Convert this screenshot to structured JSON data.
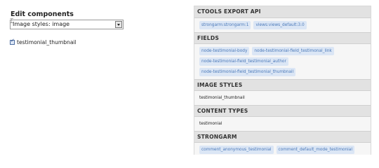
{
  "edit_components": {
    "title": "Edit components",
    "select_value": "Image styles: image",
    "checkbox_label": "testimonial_thumbnail",
    "checkbox_checked": true
  },
  "panel": {
    "sections": [
      {
        "heading": "CTOOLS EXPORT API",
        "kind": "tags",
        "items": [
          "strongarm:strongarm:1",
          "views:views_default:3.0"
        ]
      },
      {
        "heading": "FIELDS",
        "kind": "tags",
        "items": [
          "node-testimonial-body",
          "node-testimonial-field_testimonal_link",
          "node-testimonial-field_testimonial_author",
          "node-testimonial-field_testimonial_thumbnail"
        ]
      },
      {
        "heading": "IMAGE STYLES",
        "kind": "plain",
        "items": [
          "testimonial_thumbnail"
        ]
      },
      {
        "heading": "CONTENT TYPES",
        "kind": "plain",
        "items": [
          "testimonial"
        ]
      },
      {
        "heading": "STRONGARM",
        "kind": "tags",
        "items": [
          "comment_anonymous_testimonial",
          "comment_default_mode_testimonial"
        ]
      }
    ]
  },
  "colors": {
    "tag_text": "#4a78b8",
    "tag_bg": "#dbe6f5",
    "section_header_bg": "#e2e2e2",
    "panel_bg": "#f6f6f6"
  },
  "icons": {
    "select_arrow": "chevron-down-icon",
    "cursor": "text-cursor-icon",
    "checkbox_tick": "check-icon"
  }
}
